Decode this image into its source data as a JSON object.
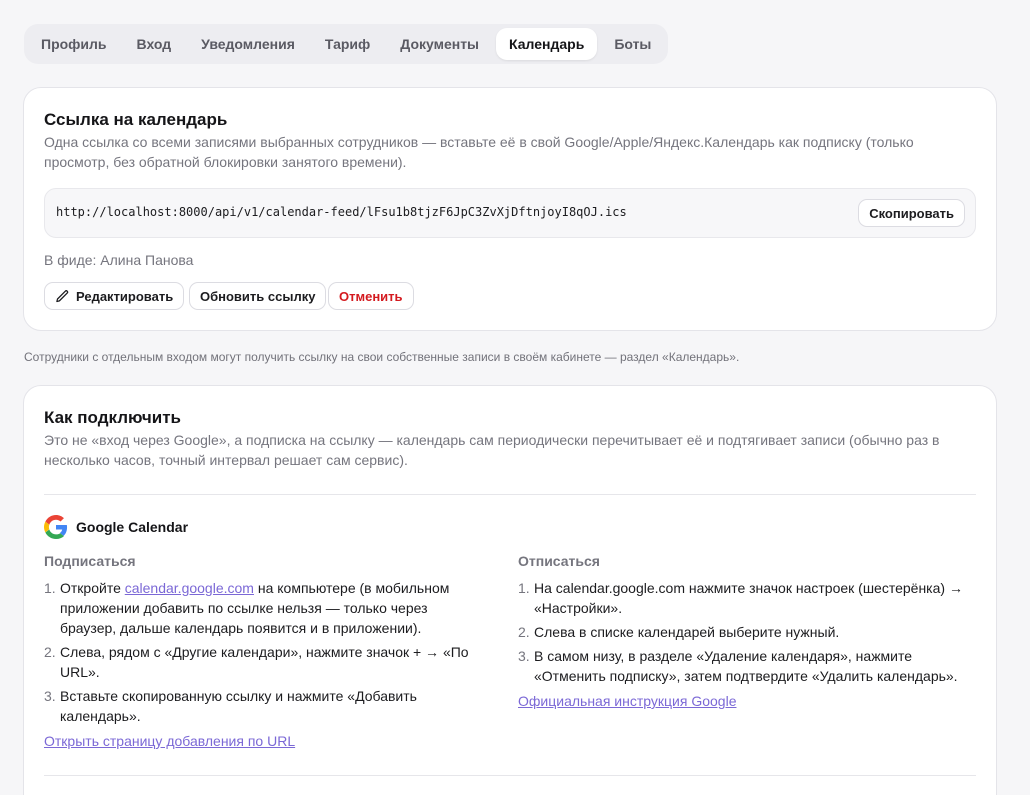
{
  "tabs": [
    {
      "label": "Профиль"
    },
    {
      "label": "Вход"
    },
    {
      "label": "Уведомления"
    },
    {
      "label": "Тариф"
    },
    {
      "label": "Документы"
    },
    {
      "label": "Календарь",
      "active": true
    },
    {
      "label": "Боты"
    }
  ],
  "feed_card": {
    "title": "Ссылка на календарь",
    "description": "Одна ссылка со всеми записями выбранных сотрудников — вставьте её в свой Google/Apple/Яндекс.Календарь как подписку (только просмотр, без обратной блокировки занятого времени).",
    "url": "http://localhost:8000/api/v1/calendar-feed/lFsu1b8tjzF6JpC3ZvXjDftnjoyI8qOJ.ics",
    "copy_label": "Скопировать",
    "in_feed_label": "В фиде: Алина Панова",
    "edit_label": "Редактировать",
    "refresh_label": "Обновить ссылку",
    "cancel_label": "Отменить"
  },
  "note": "Сотрудники с отдельным входом могут получить ссылку на свои собственные записи в своём кабинете — раздел «Календарь».",
  "connect_card": {
    "title": "Как подключить",
    "description": "Это не «вход через Google», а подписка на ссылку — календарь сам периодически перечитывает её и подтягивает записи (обычно раз в несколько часов, точный интервал решает сам сервис).",
    "provider": "Google Calendar",
    "subscribe": {
      "heading": "Подписаться",
      "steps": [
        {
          "num": "1.",
          "before": "Откройте ",
          "link": "calendar.google.com",
          "after": " на компьютере (в мобильном приложении добавить по ссылке нельзя — только через браузер, дальше календарь появится и в приложении)."
        },
        {
          "num": "2.",
          "text": "Слева, рядом с «Другие календари», нажмите значок + → «По URL»."
        },
        {
          "num": "3.",
          "text": "Вставьте скопированную ссылку и нажмите «Добавить календарь»."
        }
      ],
      "link": "Открыть страницу добавления по URL"
    },
    "unsubscribe": {
      "heading": "Отписаться",
      "steps": [
        {
          "num": "1.",
          "text": "На calendar.google.com нажмите значок настроек (шестерёнка) → «Настройки»."
        },
        {
          "num": "2.",
          "text": "Слева в списке календарей выберите нужный."
        },
        {
          "num": "3.",
          "text": "В самом низу, в разделе «Удаление календаря», нажмите «Отменить подписку», затем подтвердите «Удалить календарь»."
        }
      ],
      "link": "Официальная инструкция Google"
    }
  },
  "colors": {
    "accent_link": "#7b68d6",
    "danger": "#d41a1f"
  }
}
